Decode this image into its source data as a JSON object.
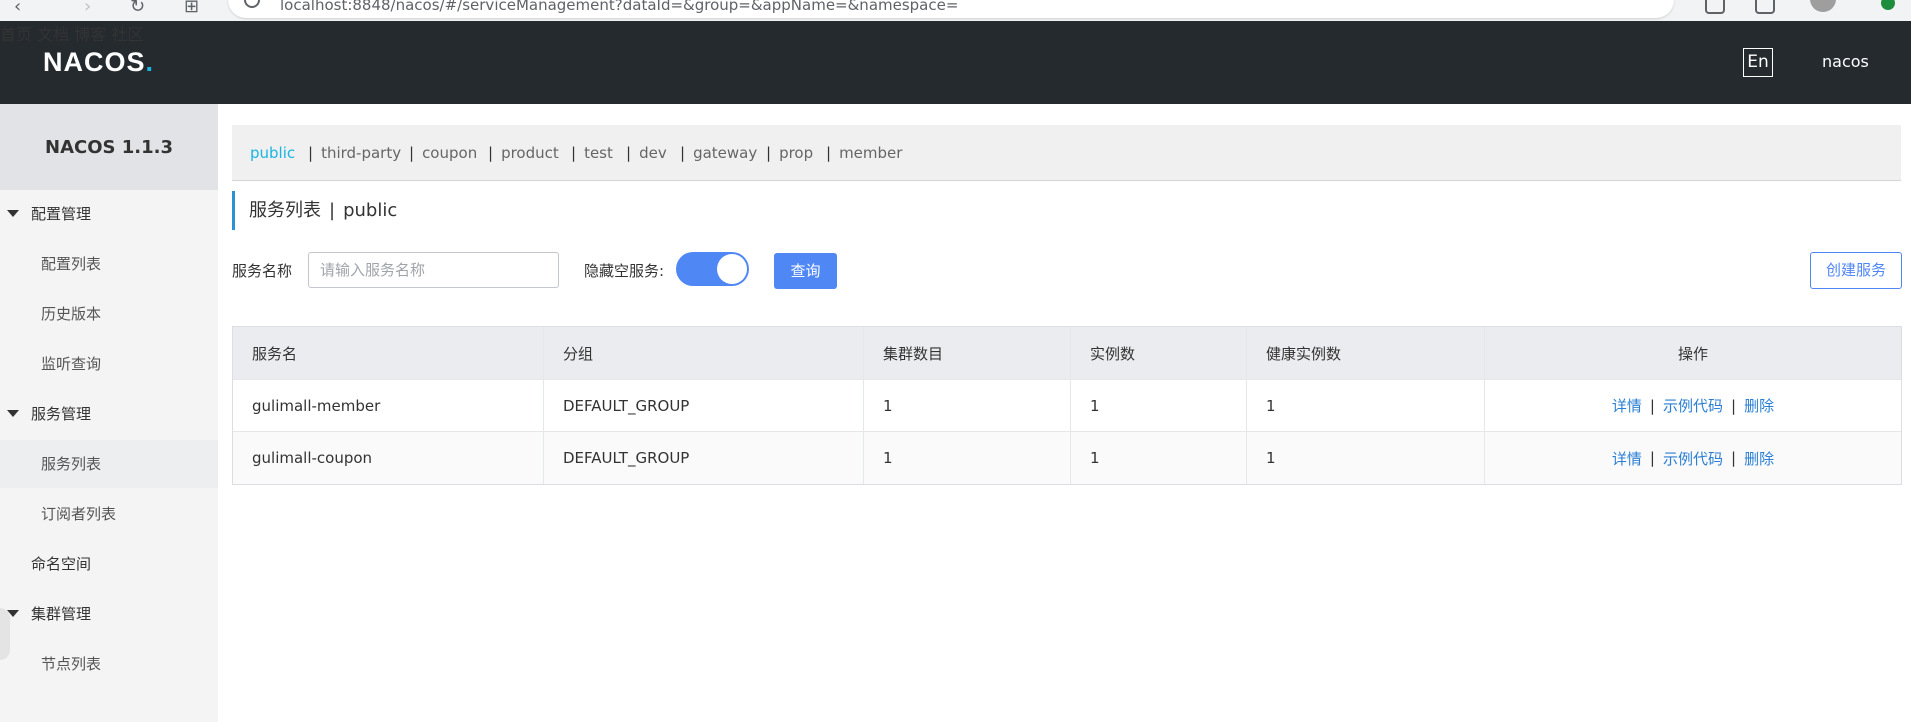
{
  "browser": {
    "url": "localhost:8848/nacos/#/serviceManagement?dataId=&group=&appName=&namespace="
  },
  "header": {
    "logo": "NACOS",
    "logo_dot": ".",
    "nav": [
      "首页",
      "文档",
      "博客",
      "社区"
    ],
    "lang": "En",
    "user": "nacos"
  },
  "sidebar": {
    "title": "NACOS 1.1.3",
    "items": [
      {
        "label": "配置管理",
        "type": "group"
      },
      {
        "label": "配置列表",
        "type": "sub"
      },
      {
        "label": "历史版本",
        "type": "sub"
      },
      {
        "label": "监听查询",
        "type": "sub"
      },
      {
        "label": "服务管理",
        "type": "group"
      },
      {
        "label": "服务列表",
        "type": "sub",
        "active": true
      },
      {
        "label": "订阅者列表",
        "type": "sub"
      },
      {
        "label": "命名空间",
        "type": "item"
      },
      {
        "label": "集群管理",
        "type": "group"
      },
      {
        "label": "节点列表",
        "type": "sub"
      }
    ]
  },
  "namespaces": {
    "active": "public",
    "items": [
      "public",
      "third-party",
      "coupon",
      "product",
      "test",
      "dev",
      "gateway",
      "prop",
      "member"
    ],
    "separator": "|"
  },
  "page": {
    "title": "服务列表",
    "separator": "|",
    "namespace": "public"
  },
  "filters": {
    "service_name_label": "服务名称",
    "service_name_placeholder": "请输入服务名称",
    "hide_empty_label": "隐藏空服务:",
    "hide_empty_on": true,
    "query_button": "查询",
    "create_button": "创建服务"
  },
  "table": {
    "columns": [
      "服务名",
      "分组",
      "集群数目",
      "实例数",
      "健康实例数",
      "操作"
    ],
    "rows": [
      {
        "name": "gulimall-member",
        "group": "DEFAULT_GROUP",
        "clusters": "1",
        "instances": "1",
        "healthy": "1"
      },
      {
        "name": "gulimall-coupon",
        "group": "DEFAULT_GROUP",
        "clusters": "1",
        "instances": "1",
        "healthy": "1"
      }
    ],
    "actions": [
      "详情",
      "示例代码",
      "删除"
    ],
    "action_separator": "|"
  },
  "colors": {
    "header_bg": "#252a2f",
    "accent": "#1bb5e3",
    "primary_button": "#4f87f5",
    "link": "#2a7fd4"
  }
}
